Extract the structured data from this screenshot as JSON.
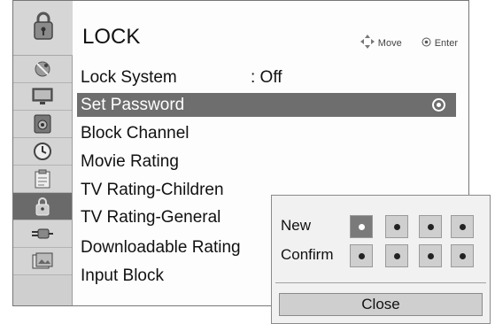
{
  "header": {
    "title": "LOCK",
    "hints": [
      {
        "icon": "dpad-arrows-icon",
        "label": "Move"
      },
      {
        "icon": "ok-circle-icon",
        "label": "Enter"
      }
    ]
  },
  "sidebar": {
    "top_icon": "padlock-icon",
    "items": [
      {
        "icon": "satellite-dish-icon",
        "active": false
      },
      {
        "icon": "monitor-icon",
        "active": false
      },
      {
        "icon": "speaker-icon",
        "active": false
      },
      {
        "icon": "clock-icon",
        "active": false
      },
      {
        "icon": "clipboard-icon",
        "active": false
      },
      {
        "icon": "padlock-icon",
        "active": true
      },
      {
        "icon": "plug-icon",
        "active": false
      },
      {
        "icon": "photo-icon",
        "active": false
      }
    ]
  },
  "menu": {
    "items": [
      {
        "label": "Lock System",
        "value": ": Off",
        "selected": false
      },
      {
        "label": "Set Password",
        "value": "",
        "selected": true
      },
      {
        "label": "Block Channel",
        "value": "",
        "selected": false
      },
      {
        "label": "Movie Rating",
        "value": "",
        "selected": false
      },
      {
        "label": "TV Rating-Children",
        "value": "",
        "selected": false
      },
      {
        "label": "TV Rating-General",
        "value": "",
        "selected": false
      },
      {
        "label": "Downloadable Rating",
        "value": "",
        "selected": false
      },
      {
        "label": "Input Block",
        "value": "",
        "selected": false
      }
    ]
  },
  "password_popup": {
    "new_label": "New",
    "confirm_label": "Confirm",
    "digits_per_row": 4,
    "active_box": {
      "row": "new",
      "index": 0
    },
    "close_label": "Close"
  }
}
